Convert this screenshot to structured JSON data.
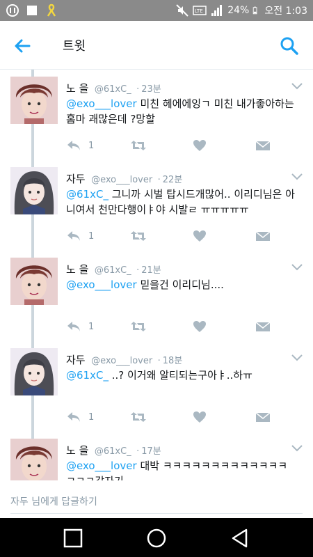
{
  "status_bar": {
    "battery": "24%",
    "time": "오전 1:03",
    "icons": [
      "notification-icon",
      "image-icon",
      "ribbon-icon",
      "mute-icon",
      "lte-icon",
      "signal-icon",
      "battery-icon"
    ]
  },
  "header": {
    "title": "트윗",
    "back_icon": "back-arrow-icon",
    "search_icon": "search-icon"
  },
  "tweets": [
    {
      "name": "노 을",
      "handle": "@61xC_",
      "time": "23분",
      "mention": "@exo___lover",
      "text": " 미친 헤에에잉ㄱ 미친 내가좋아하는홈마 괘많은데 ?망할",
      "reply_count": "1"
    },
    {
      "name": "자두",
      "handle": "@exo___lover",
      "time": "22분",
      "mention": "@61xC_",
      "text": " 그니까 시벌 탑시드개많어.. 이리디님은 아니여서 천만다행이ㅑ야 시발ㄹ ㅠㅠㅠㅠㅠ",
      "reply_count": "1"
    },
    {
      "name": "노 을",
      "handle": "@61xC_",
      "time": "21분",
      "mention": "@exo___lover",
      "text": " 믿을건 이리디님....",
      "reply_count": "1"
    },
    {
      "name": "자두",
      "handle": "@exo___lover",
      "time": "18분",
      "mention": "@61xC_",
      "text": " ..? 이거왜 알티되는구아ㅑ..하ㅠ",
      "reply_count": "1"
    },
    {
      "name": "노 을",
      "handle": "@61xC_",
      "time": "17분",
      "mention": "@exo___lover",
      "text": " 대박 ㅋㅋㅋㅋㅋㅋㅋㅋㅋㅋㅋㅋㅋㅋㅋㅋ갑자기",
      "reply_count": ""
    }
  ],
  "reply_bar": {
    "placeholder": "자두 님에게 답글하기"
  },
  "colors": {
    "accent": "#1da1f2",
    "muted": "#8899a6",
    "status_bar": "#8a8a8a"
  }
}
